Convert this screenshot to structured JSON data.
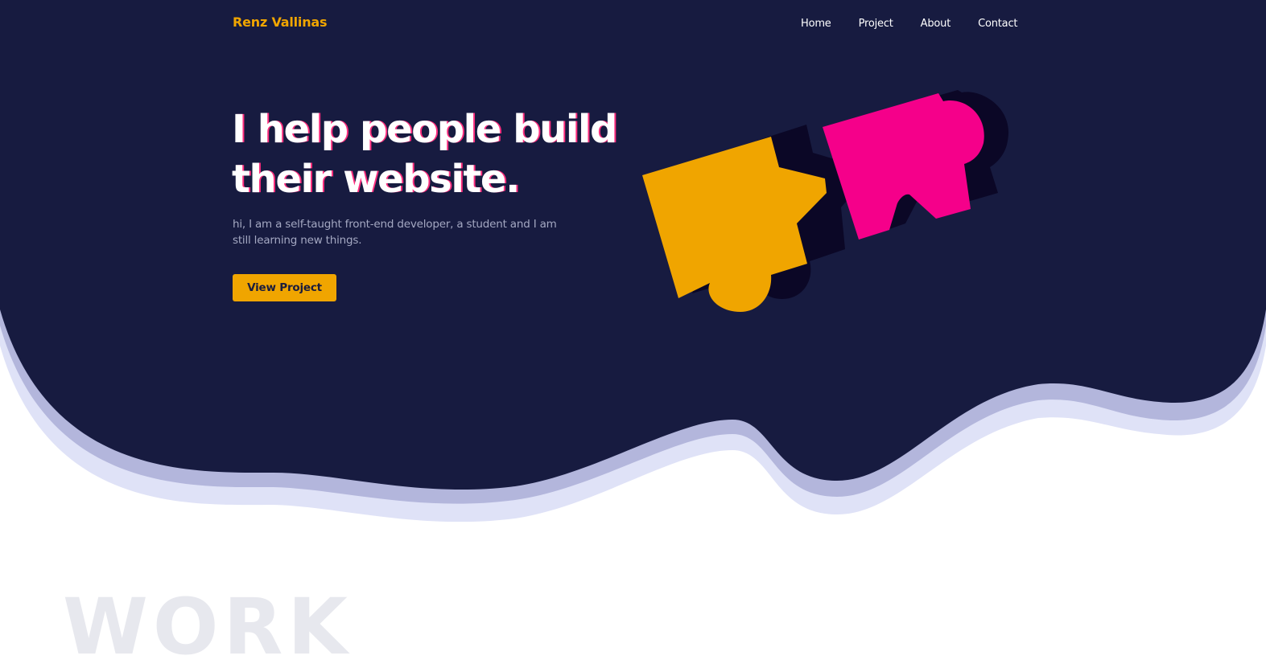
{
  "header": {
    "logo": "Renz Vallinas",
    "nav": [
      "Home",
      "Project",
      "About",
      "Contact"
    ]
  },
  "hero": {
    "headline_lines": [
      "I help people build",
      "their website."
    ],
    "intro": "hi, I am a self-taught front-end developer, a student and I am still learning new things.",
    "cta_label": "View Project"
  },
  "work_section": {
    "heading": "WORK"
  },
  "colors": {
    "hero_background": "#171b40",
    "accent": "#f0a500",
    "puzzle_pink": "#f5008a",
    "puzzle_shadow": "#0b0726",
    "wave_layer_1": "#b3b6dc",
    "wave_layer_2": "#dfe2f7"
  },
  "icons": {
    "illustration": "puzzle-pieces-illustration"
  }
}
